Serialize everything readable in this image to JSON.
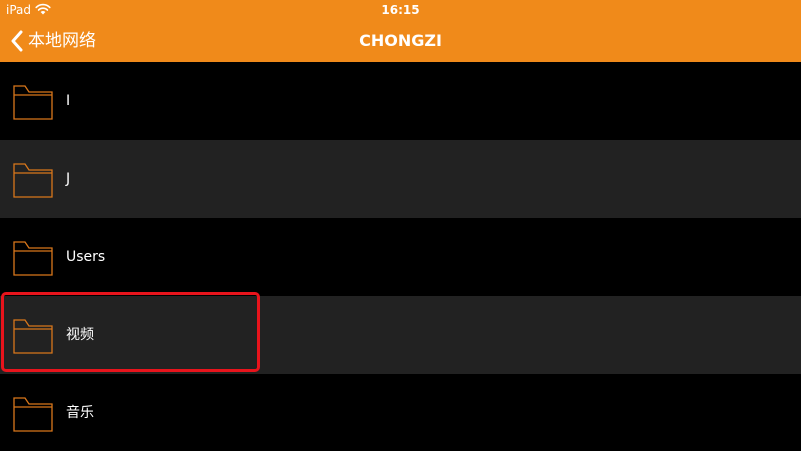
{
  "status_bar": {
    "device": "iPad",
    "time": "16:15",
    "wifi_icon": "wifi-icon"
  },
  "nav": {
    "back_label": "本地网络",
    "back_icon": "chevron-left-icon",
    "title": "CHONGZI"
  },
  "folders": [
    {
      "name": "I"
    },
    {
      "name": "J"
    },
    {
      "name": "Users"
    },
    {
      "name": "视频"
    },
    {
      "name": "音乐"
    }
  ],
  "colors": {
    "accent": "#f08a1a",
    "row_alt": "#222222",
    "highlight": "#e8141c",
    "folder_stroke": "#d9771b"
  }
}
